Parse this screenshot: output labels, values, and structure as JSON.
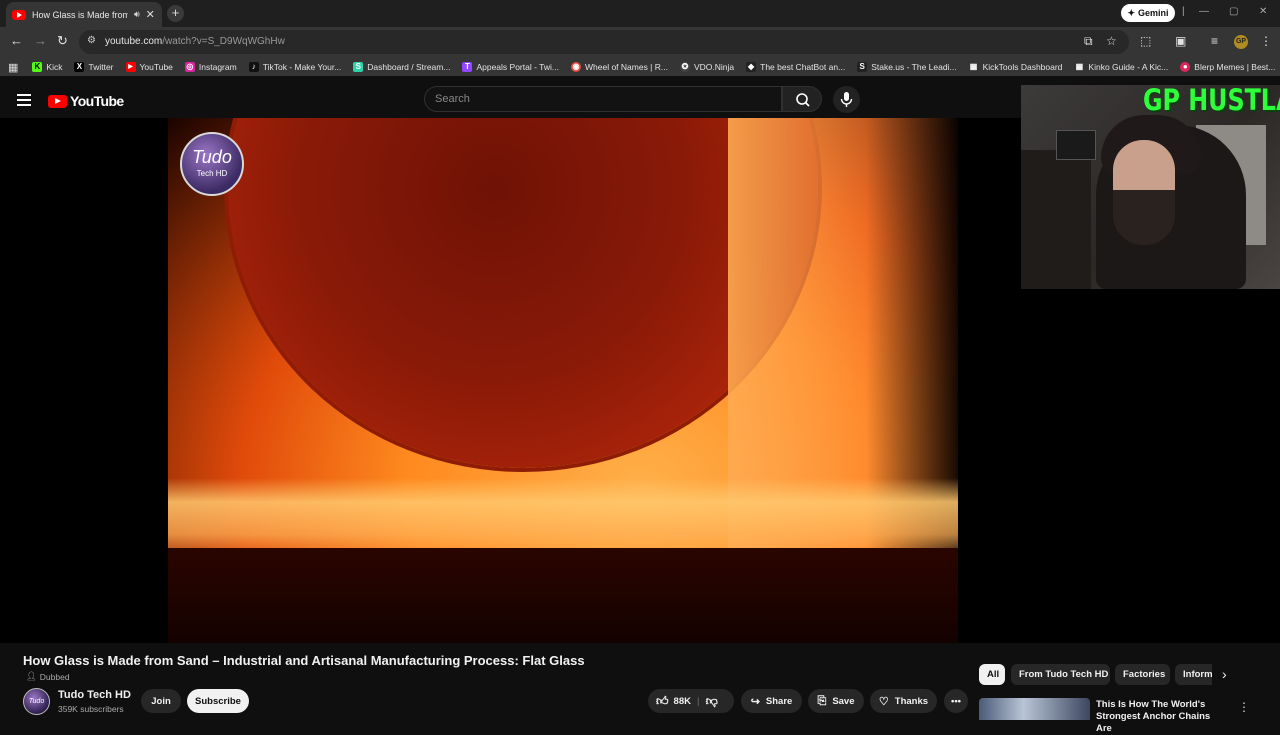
{
  "browser": {
    "tab_title": "How Glass is Made from Sa",
    "gemini_label": "Gemini",
    "url_host": "youtube.com",
    "url_path": "/watch?v=S_D9WqWGhHw"
  },
  "bookmarks": [
    {
      "label": "Kick",
      "color": "#53fc18",
      "glyph": "K"
    },
    {
      "label": "Twitter",
      "color": "#000000",
      "glyph": "X"
    },
    {
      "label": "YouTube",
      "color": "#ff0000",
      "glyph": "▶"
    },
    {
      "label": "Instagram",
      "color": "#d6249f",
      "glyph": "◎"
    },
    {
      "label": "TikTok - Make Your...",
      "color": "#111111",
      "glyph": "♪"
    },
    {
      "label": "Dashboard / Stream...",
      "color": "#2fd1a8",
      "glyph": "S"
    },
    {
      "label": "Appeals Portal - Twi...",
      "color": "#9146ff",
      "glyph": "T"
    },
    {
      "label": "Wheel of Names | R...",
      "color": "#e84b3c",
      "glyph": "◉"
    },
    {
      "label": "VDO.Ninja",
      "color": "#444444",
      "glyph": "✪"
    },
    {
      "label": "The best ChatBot an...",
      "color": "#222222",
      "glyph": "◆"
    },
    {
      "label": "Stake.us - The Leadi...",
      "color": "#222222",
      "glyph": "S"
    },
    {
      "label": "KickTools Dashboard",
      "color": "#333333",
      "glyph": "▦"
    },
    {
      "label": "Kinko Guide - A Kic...",
      "color": "#333333",
      "glyph": "▦"
    },
    {
      "label": "Blerp Memes | Best...",
      "color": "#e0245e",
      "glyph": "●"
    }
  ],
  "youtube": {
    "logo_text": "YouTube",
    "search_placeholder": "Search"
  },
  "player": {
    "channel_watermark_line1": "Tudo",
    "channel_watermark_line2": "Tech HD"
  },
  "webcam": {
    "overlay_text": "GP HUSTLA"
  },
  "video": {
    "title": "How Glass is Made from Sand – Industrial and Artisanal Manufacturing Process: Flat Glass",
    "dubbed_label": "Dubbed",
    "channel_name": "Tudo Tech HD",
    "subscribers": "359K subscribers",
    "join_label": "Join",
    "subscribe_label": "Subscribe",
    "likes": "88K",
    "share_label": "Share",
    "save_label": "Save",
    "thanks_label": "Thanks"
  },
  "chips": [
    "All",
    "From Tudo Tech HD",
    "Factories",
    "Inform"
  ],
  "recommendation": {
    "title": "This Is How The World's Strongest Anchor Chains Are"
  }
}
